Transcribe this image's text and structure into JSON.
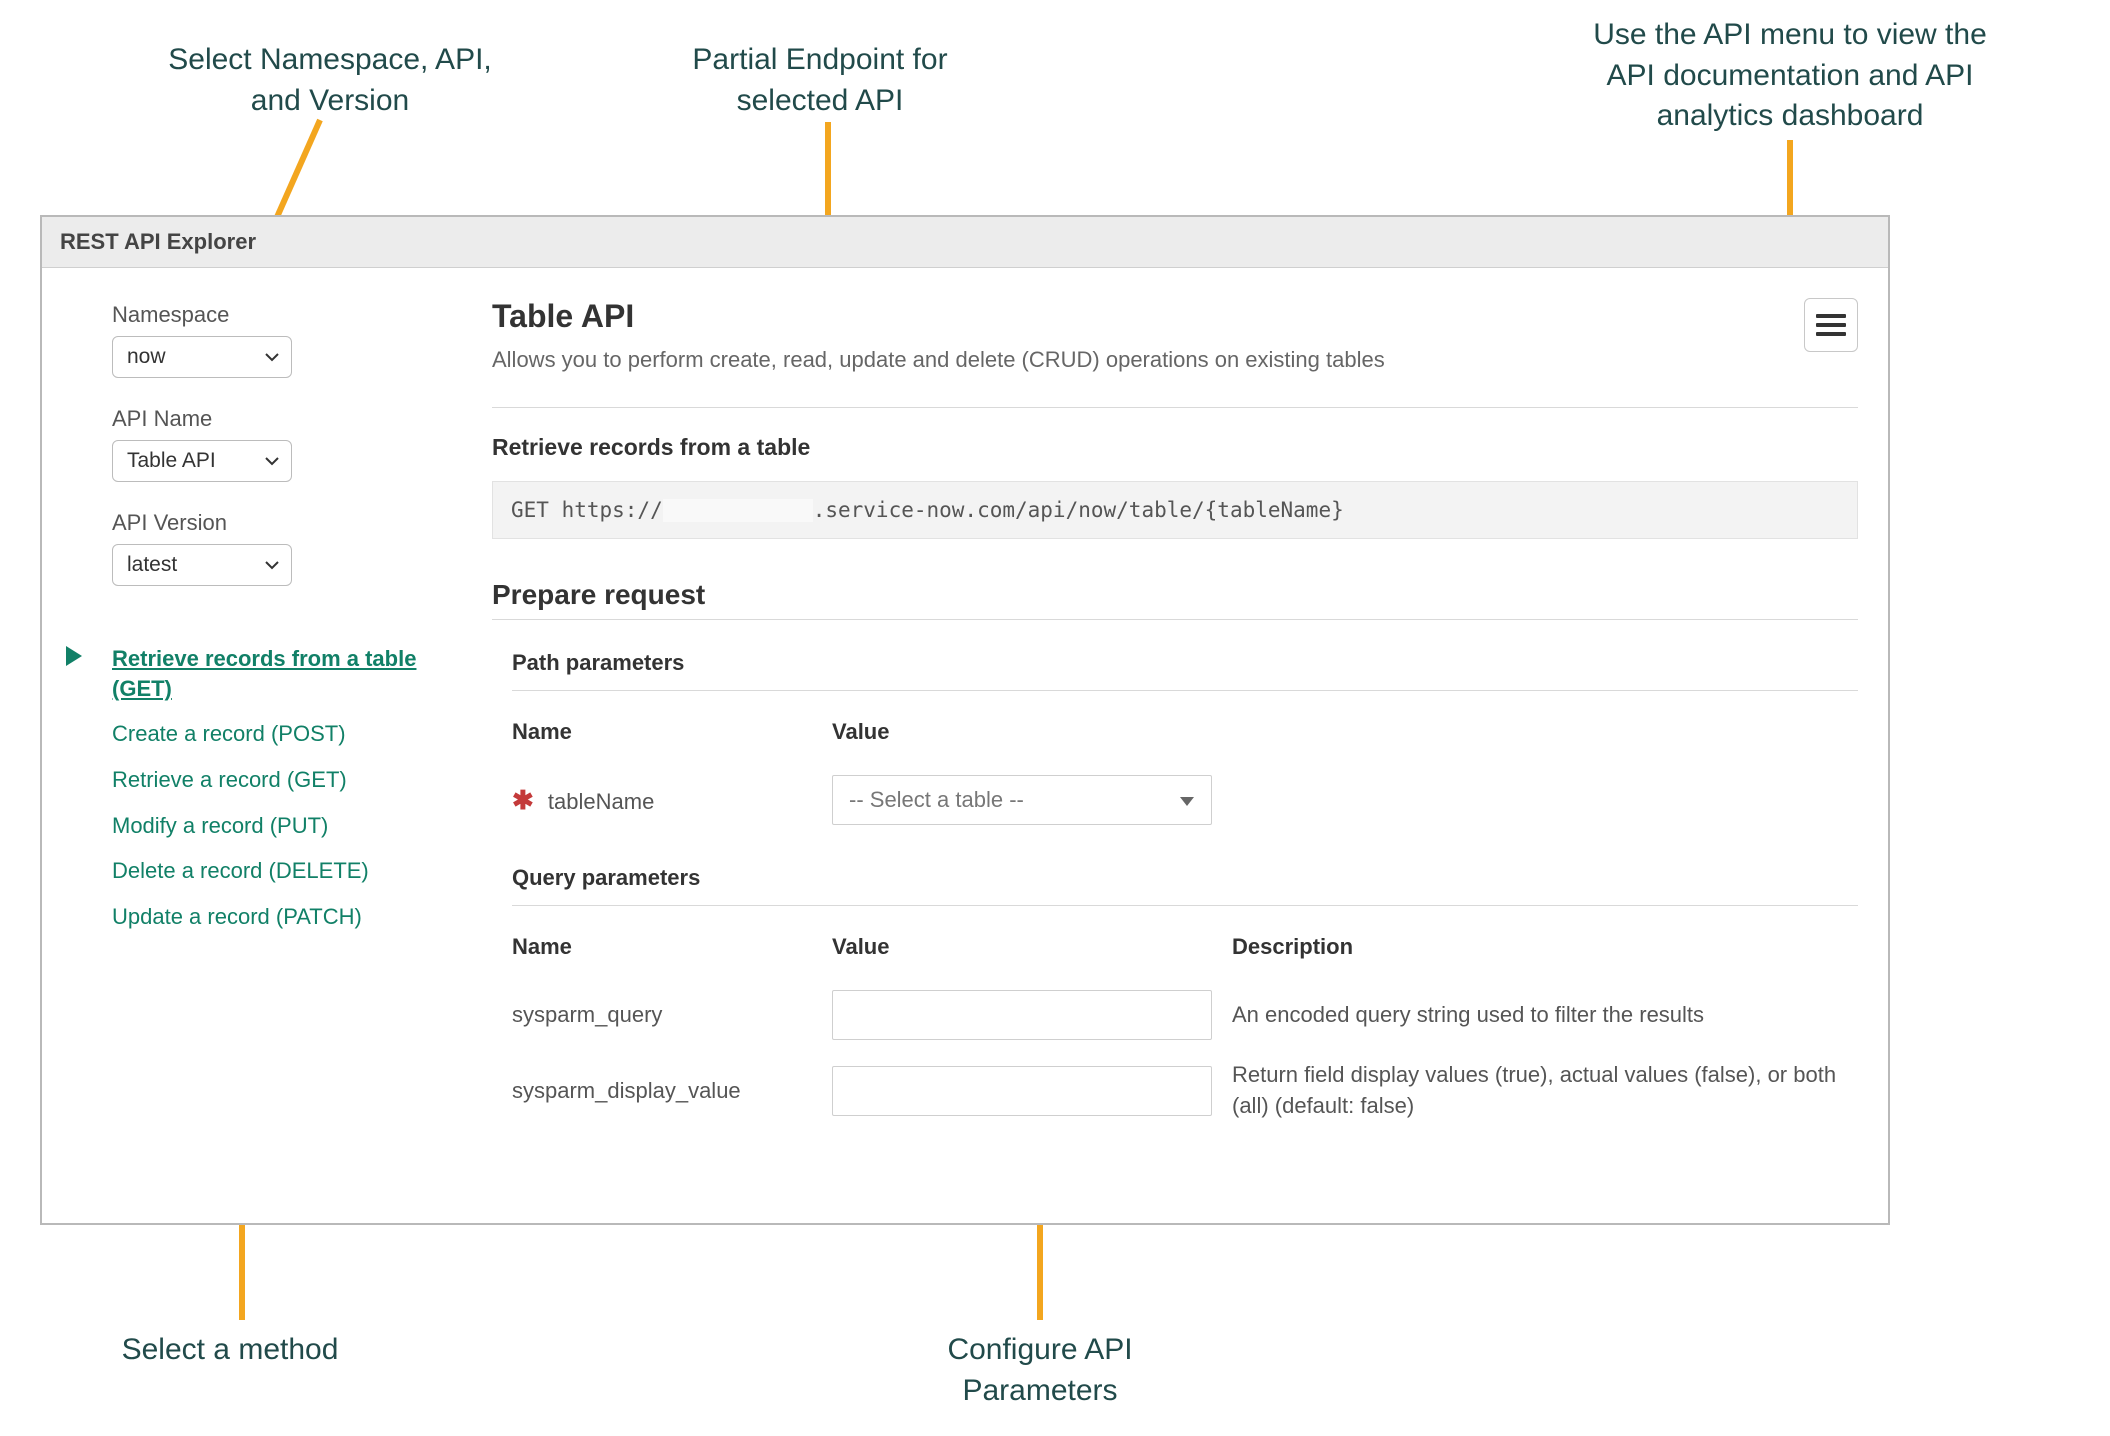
{
  "callouts": {
    "top_left": "Select Namespace, API,\nand Version",
    "top_middle": "Partial Endpoint for\nselected API",
    "top_right": "Use the API menu to view the\nAPI documentation and API\nanalytics dashboard",
    "bottom_left": "Select a method",
    "bottom_middle": "Configure API\nParameters"
  },
  "panel_title": "REST API Explorer",
  "sidebar": {
    "namespace_label": "Namespace",
    "namespace_value": "now",
    "apiname_label": "API Name",
    "apiname_value": "Table API",
    "apiversion_label": "API Version",
    "apiversion_value": "latest",
    "methods": [
      {
        "label": "Retrieve records from a table  (GET)",
        "active": true
      },
      {
        "label": "Create a record  (POST)",
        "active": false
      },
      {
        "label": "Retrieve a record  (GET)",
        "active": false
      },
      {
        "label": "Modify a record  (PUT)",
        "active": false
      },
      {
        "label": "Delete a record  (DELETE)",
        "active": false
      },
      {
        "label": "Update a record  (PATCH)",
        "active": false
      }
    ]
  },
  "main": {
    "api_title": "Table API",
    "api_desc": "Allows you to perform create, read, update and delete (CRUD) operations on existing tables",
    "retrieve_title": "Retrieve records from a table",
    "endpoint_prefix": "GET https://",
    "endpoint_suffix": ".service-now.com/api/now/table/{tableName}",
    "prepare_title": "Prepare request",
    "path_params_title": "Path parameters",
    "path_params_headers": {
      "name": "Name",
      "value": "Value"
    },
    "path_params": {
      "tableName": {
        "name": "tableName",
        "placeholder": "-- Select a table --",
        "required": true
      }
    },
    "query_params_title": "Query parameters",
    "query_params_headers": {
      "name": "Name",
      "value": "Value",
      "desc": "Description"
    },
    "query_params": [
      {
        "name": "sysparm_query",
        "value": "",
        "desc": "An encoded query string used to filter the results"
      },
      {
        "name": "sysparm_display_value",
        "value": "",
        "desc": "Return field display values (true), actual values (false), or both (all) (default: false)"
      }
    ]
  }
}
